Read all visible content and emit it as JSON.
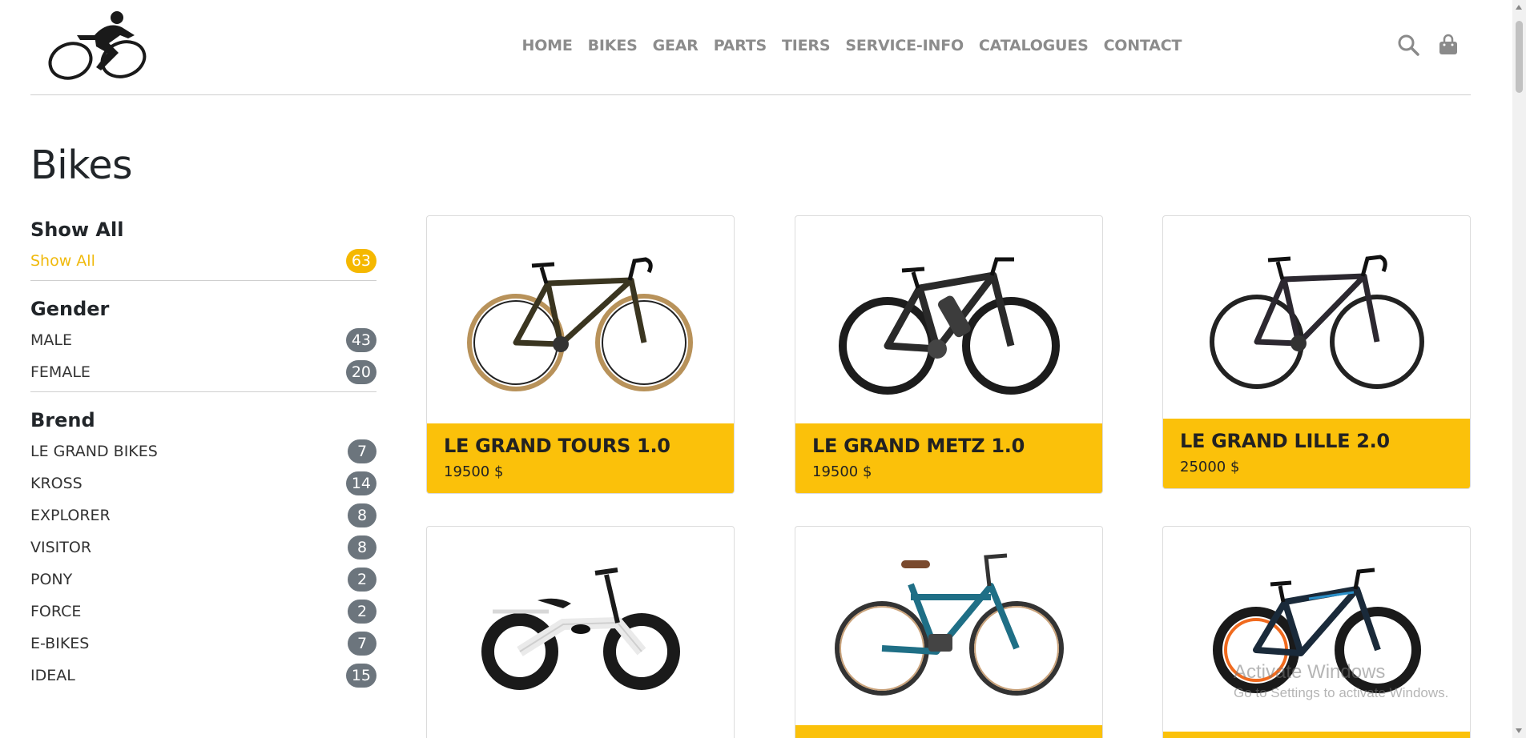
{
  "header": {
    "logo_icon": "cyclist-logo-icon",
    "nav": [
      "HOME",
      "BIKES",
      "GEAR",
      "PARTS",
      "TIERS",
      "SERVICE-INFO",
      "CATALOGUES",
      "CONTACT"
    ],
    "icons": [
      "search-icon",
      "shopping-bag-icon"
    ]
  },
  "page": {
    "title": "Bikes"
  },
  "sidebar": {
    "show_all": {
      "title": "Show All",
      "items": [
        {
          "label": "Show All",
          "count": "63"
        }
      ]
    },
    "gender": {
      "title": "Gender",
      "items": [
        {
          "label": "MALE",
          "count": "43"
        },
        {
          "label": "FEMALE",
          "count": "20"
        }
      ]
    },
    "brend": {
      "title": "Brend",
      "items": [
        {
          "label": "LE GRAND BIKES",
          "count": "7"
        },
        {
          "label": "KROSS",
          "count": "14"
        },
        {
          "label": "EXPLORER",
          "count": "8"
        },
        {
          "label": "VISITOR",
          "count": "8"
        },
        {
          "label": "PONY",
          "count": "2"
        },
        {
          "label": "FORCE",
          "count": "2"
        },
        {
          "label": "E-BIKES",
          "count": "7"
        },
        {
          "label": "IDEAL",
          "count": "15"
        }
      ]
    }
  },
  "products": [
    {
      "name": "LE GRAND TOURS 1.0",
      "price": "19500 $",
      "image": "gravel-bike-image"
    },
    {
      "name": "LE GRAND METZ 1.0",
      "price": "19500 $",
      "image": "e-mtb-image"
    },
    {
      "name": "LE GRAND LILLE 2.0",
      "price": "25000 $",
      "image": "road-bike-image"
    },
    {
      "name": "",
      "price": "",
      "image": "balance-bike-image"
    },
    {
      "name": "",
      "price": "",
      "image": "city-e-bike-image"
    },
    {
      "name": "",
      "price": "",
      "image": "kids-mtb-image"
    }
  ],
  "watermark": {
    "line1": "Activate Windows",
    "line2": "Go to Settings to activate Windows."
  },
  "colors": {
    "accent": "#fbc10a",
    "badge": "#6c757d",
    "active_link": "#f0b90b"
  }
}
